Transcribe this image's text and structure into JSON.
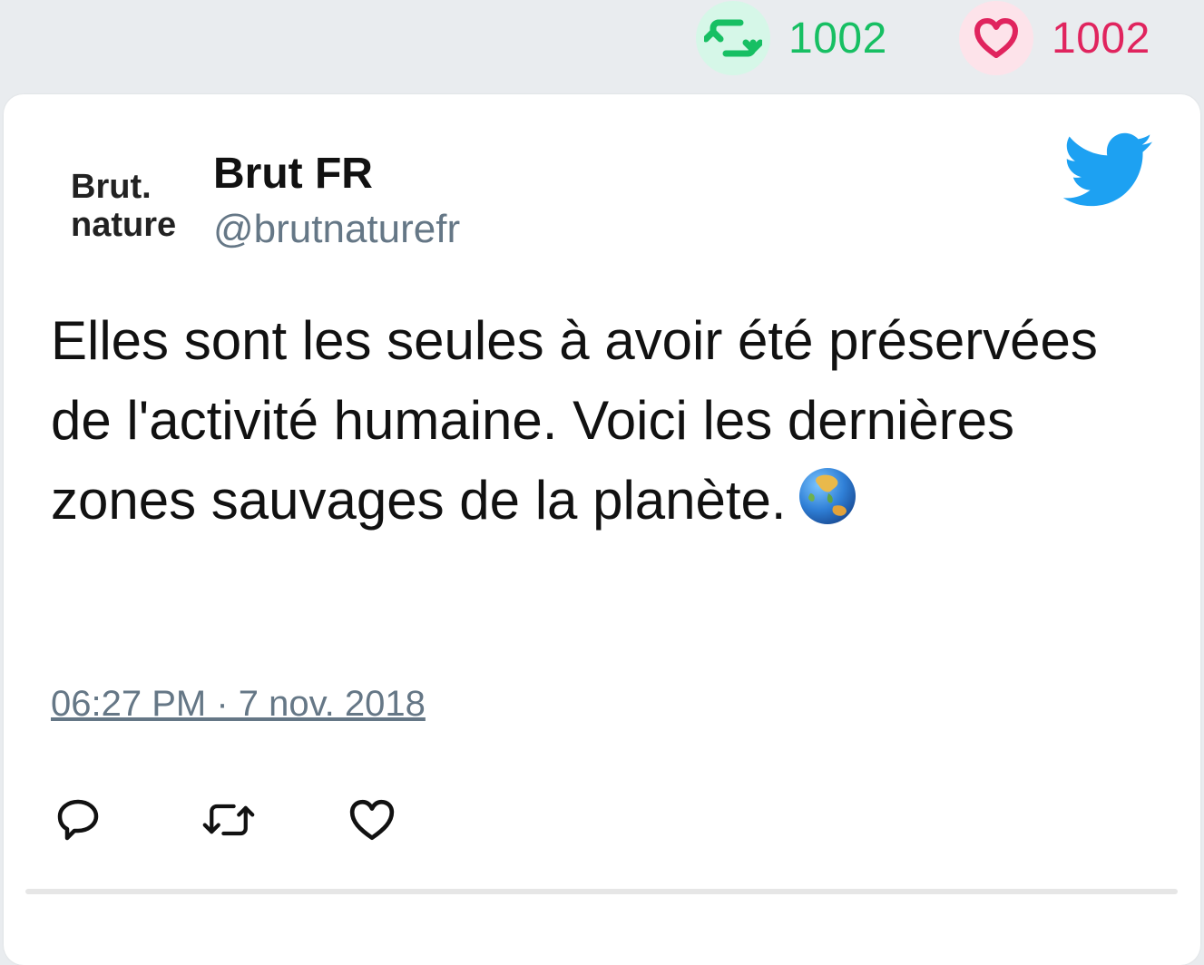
{
  "stats": {
    "retweet_count": "1002",
    "like_count": "1002",
    "retweet_color": "#17bf63",
    "like_color": "#e0245e"
  },
  "tweet": {
    "avatar": {
      "line1": "Brut.",
      "line2": "nature"
    },
    "display_name": "Brut FR",
    "handle": "@brutnaturefr",
    "text": "Elles sont les seules à avoir été préservées de l'activité humaine. Voici les dernières zones sauvages de la planète.",
    "emoji": "globe-asia-australia-icon",
    "timestamp": "06:27 PM · 7 nov. 2018",
    "brand_icon": "twitter-bird-icon",
    "brand_color": "#1da1f2"
  },
  "actions": [
    {
      "icon": "reply-icon"
    },
    {
      "icon": "retweet-icon"
    },
    {
      "icon": "like-icon"
    }
  ]
}
